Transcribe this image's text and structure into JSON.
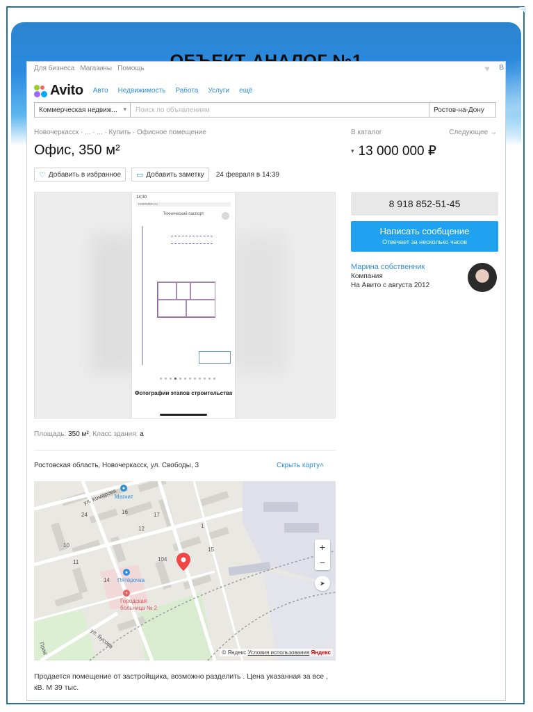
{
  "slide": {
    "title": "ОБЪЕКТ-АНАЛОГ №1"
  },
  "topbar": {
    "items": [
      "Для бизнеса",
      "Магазины",
      "Помощь"
    ],
    "edge_letter": "В",
    "heart_icon": "heart-icon"
  },
  "nav": {
    "logo_text": "Avito",
    "logo_colors": [
      "#97cf26",
      "#a169f7",
      "#ff6163",
      "#0af"
    ],
    "links": [
      "Авто",
      "Недвижимость",
      "Работа",
      "Услуги",
      "ещё"
    ]
  },
  "search": {
    "category": "Коммерческая недвиж...",
    "placeholder": "Поиск по объявлениям",
    "city": "Ростов-на-Дону"
  },
  "breadcrumbs": "Новочеркасск · ... · ... · Купить · Офисное помещение",
  "catalog_link": "В каталог",
  "next_link": "Следующее →",
  "listing": {
    "title": "Офис, 350 м²",
    "price": "13 000 000 ₽",
    "add_favorite": "Добавить в избранное",
    "add_note": "Добавить заметку",
    "date": "24 февраля в 14:39"
  },
  "gallery": {
    "status_time": "14:30",
    "url_text": "rostovdon.ru",
    "doc_heading": "Технический паспорт",
    "caption": "Фотографии этапов строительства",
    "active_dot": 3,
    "dot_count": 12
  },
  "params": {
    "area_label": "Площадь:",
    "area_value": "350 м²",
    "class_label": "Класс здания:",
    "class_value": "a"
  },
  "address": {
    "text": "Ростовская область, Новочеркасск, ул. Свободы, 3",
    "hide_map": "Скрыть карту"
  },
  "map": {
    "streets": [
      "ул. Комарова",
      "ул. Бусова",
      "Прав"
    ],
    "house_numbers": [
      "24",
      "16",
      "17",
      "10",
      "11",
      "12",
      "104",
      "14",
      "15",
      "1"
    ],
    "pois": [
      "Магнит",
      "Пятёрочка",
      "Городская больница № 2"
    ],
    "zoom_in": "+",
    "zoom_out": "−",
    "attribution": "© Яндекс",
    "terms": "Условия использования",
    "yandex": "Яндекс"
  },
  "description": "Продается помещение от застройщика, возможно разделить . Цена указанная за все , кВ. М 39 тыс.",
  "contact": {
    "phone": "8 918 852-51-45",
    "write_title": "Написать сообщение",
    "write_sub": "Отвечает за несколько часов",
    "seller_name": "Марина собственник",
    "seller_type": "Компания",
    "seller_since": "На Авито с августа 2012"
  }
}
